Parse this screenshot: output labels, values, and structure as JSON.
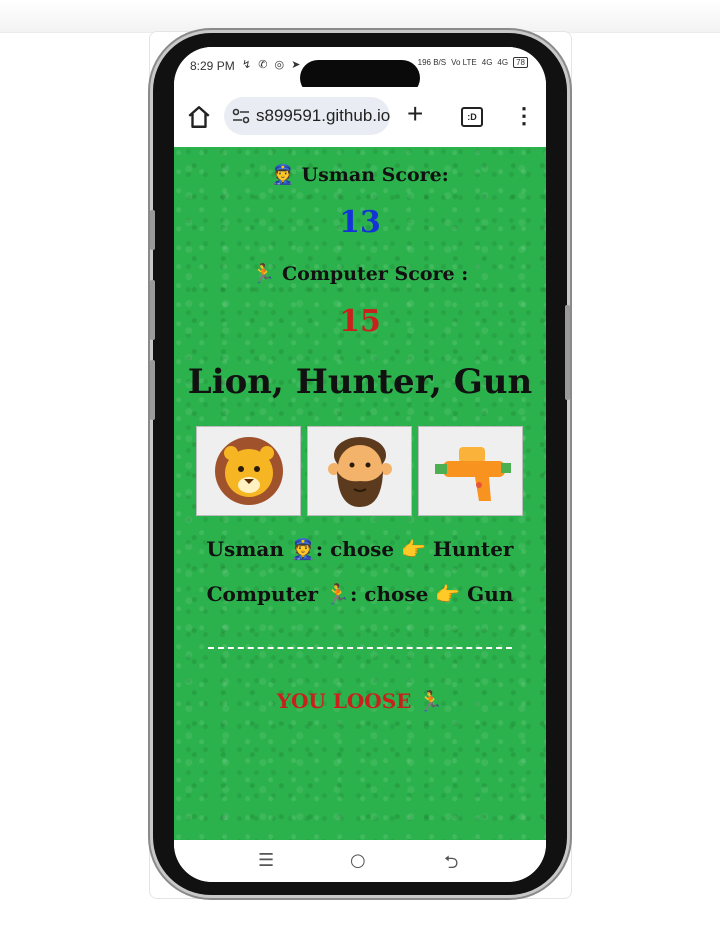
{
  "statusbar": {
    "time": "8:29 PM",
    "left_icons": "↯ ✆ ◎ ➤",
    "network": "196 B/S",
    "volte": "Vo LTE",
    "signal1": "4G",
    "signal2": "4G",
    "battery": "78"
  },
  "browser": {
    "url": "s899591.github.io",
    "new_tab_label": "+",
    "tabs_label": ":D",
    "menu_label": "⋮"
  },
  "game": {
    "player_label": "👮 Usman Score:",
    "player_score": "13",
    "player_score_color": "#1433d6",
    "computer_label": "🏃 Computer Score :",
    "computer_score": "15",
    "computer_score_color": "#c8211c",
    "title": "Lion, Hunter, Gun",
    "choices": [
      {
        "name": "Lion",
        "icon": "lion-icon"
      },
      {
        "name": "Hunter",
        "icon": "bearded-man-icon"
      },
      {
        "name": "Gun",
        "icon": "water-gun-icon"
      }
    ],
    "player_choice": "Usman 👮: chose 👉 Hunter",
    "computer_choice": "Computer 🏃: chose 👉 Gun",
    "divider": "------------------------------------",
    "verdict": "YOU LOOSE 🏃",
    "verdict_color": "#c8211c"
  },
  "navbar": {
    "recents": "☰",
    "home": "○",
    "back": "⮌"
  }
}
